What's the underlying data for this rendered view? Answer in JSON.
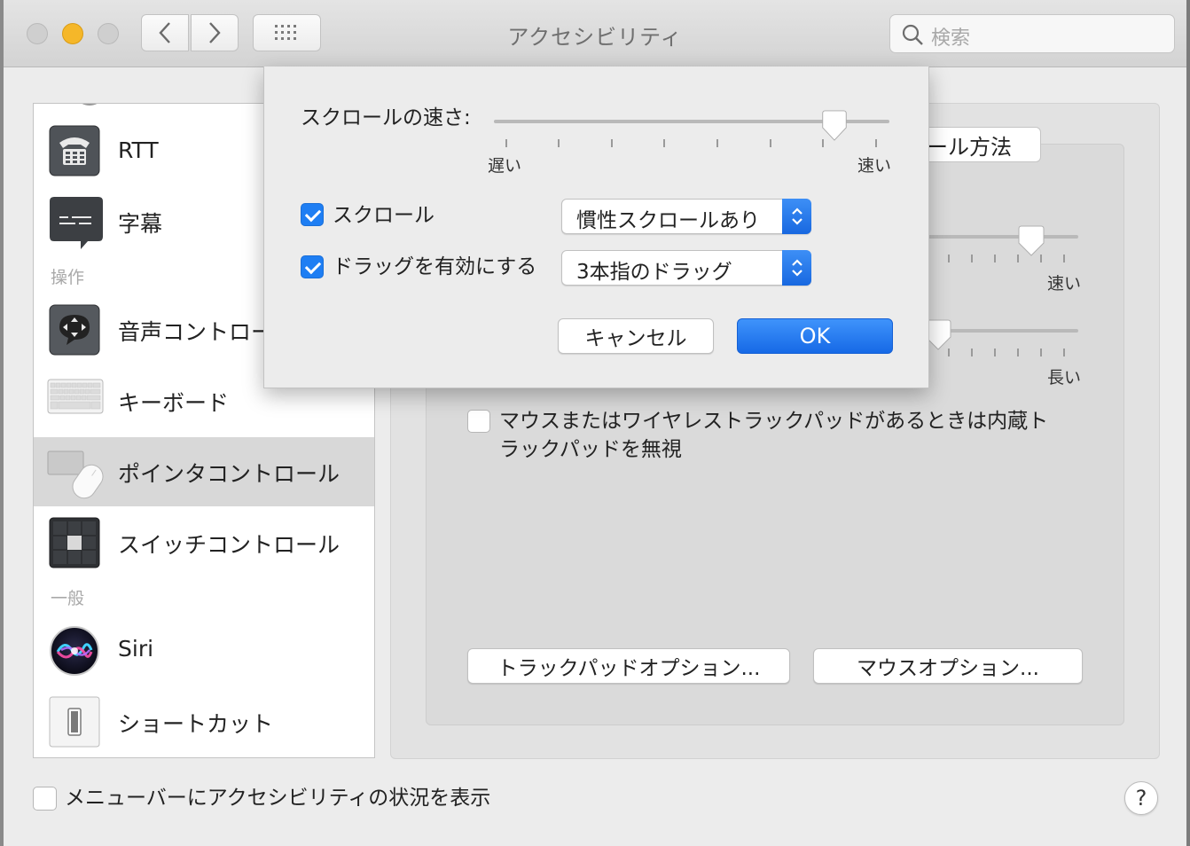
{
  "window": {
    "title": "アクセシビリティ"
  },
  "search": {
    "placeholder": "検索"
  },
  "sidebar": {
    "items": [
      {
        "label": "RTT",
        "icon": "telephone-icon"
      },
      {
        "label": "字幕",
        "icon": "captions-icon"
      },
      {
        "label": "音声コントロール",
        "icon": "voice-control-icon"
      },
      {
        "label": "キーボード",
        "icon": "keyboard-icon"
      },
      {
        "label": "ポインタコントロール",
        "icon": "pointer-control-icon",
        "selected": true
      },
      {
        "label": "スイッチコントロール",
        "icon": "switch-control-icon"
      },
      {
        "label": "Siri",
        "icon": "siri-icon"
      },
      {
        "label": "ショートカット",
        "icon": "shortcut-icon"
      }
    ],
    "sections": {
      "operation": "操作",
      "general": "一般"
    }
  },
  "panel": {
    "tab_partial": "ール方法",
    "slider1_right": "速い",
    "slider2_right": "長い",
    "slider1_level": 0.7,
    "slider2_level": 0.1,
    "ignore_trackpad": {
      "line1": "マウスまたはワイヤレストラックパッドがあるときは内蔵ト",
      "line2": "ラックパッドを無視",
      "checked": false
    },
    "trackpad_options_button": "トラックパッドオプション...",
    "mouse_options_button": "マウスオプション..."
  },
  "footer": {
    "menubar_status_label": "メニューバーにアクセシビリティの状況を表示",
    "menubar_status_checked": false,
    "help": "?"
  },
  "sheet": {
    "scroll_speed_label": "スクロールの速さ:",
    "slow_label": "遅い",
    "fast_label": "速い",
    "scroll_speed_level": 0.86,
    "scroll_checkbox": {
      "label": "スクロール",
      "checked": true
    },
    "scroll_popup": {
      "value": "慣性スクロールあり"
    },
    "drag_checkbox": {
      "label": "ドラッグを有効にする",
      "checked": true
    },
    "drag_popup": {
      "value": "3本指のドラッグ"
    },
    "cancel_button": "キャンセル",
    "ok_button": "OK"
  },
  "colors": {
    "accent": "#1e7ef3",
    "traffic_minimize": "#f5b729",
    "selection": "#d8d8d8"
  }
}
